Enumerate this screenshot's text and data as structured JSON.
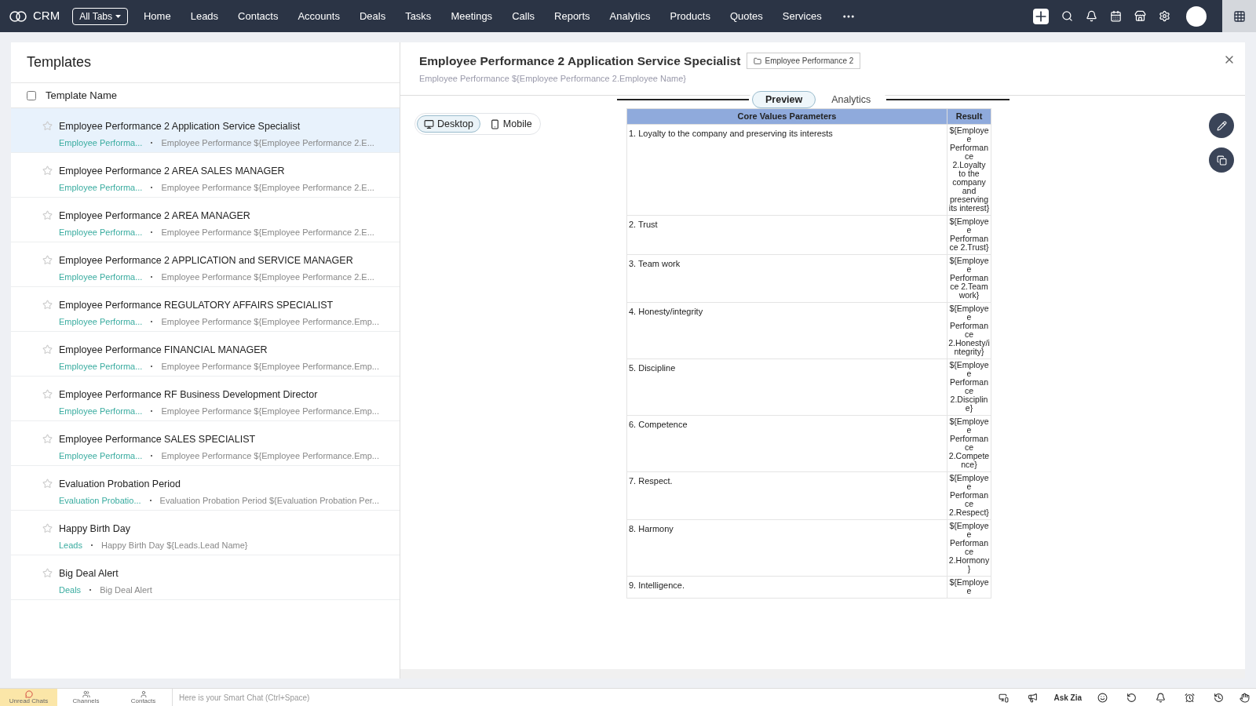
{
  "app": {
    "name": "CRM",
    "tabs_menu": "All Tabs"
  },
  "nav": [
    "Home",
    "Leads",
    "Contacts",
    "Accounts",
    "Deals",
    "Tasks",
    "Meetings",
    "Calls",
    "Reports",
    "Analytics",
    "Products",
    "Quotes",
    "Services"
  ],
  "templates": {
    "title": "Templates",
    "column": "Template Name",
    "select_all": false,
    "items": [
      {
        "name": "Employee Performance 2 Application Service Specialist",
        "module": "Employee Performa...",
        "subject": "Employee Performance ${Employee Performance 2.E...",
        "selected": true
      },
      {
        "name": "Employee Performance 2 AREA SALES MANAGER",
        "module": "Employee Performa...",
        "subject": "Employee Performance ${Employee Performance 2.E...",
        "selected": false
      },
      {
        "name": "Employee Performance 2 AREA MANAGER",
        "module": "Employee Performa...",
        "subject": "Employee Performance ${Employee Performance 2.E...",
        "selected": false
      },
      {
        "name": "Employee Performance 2 APPLICATION and SERVICE MANAGER",
        "module": "Employee Performa...",
        "subject": "Employee Performance ${Employee Performance 2.E...",
        "selected": false
      },
      {
        "name": "Employee Performance REGULATORY AFFAIRS SPECIALIST",
        "module": "Employee Performa...",
        "subject": "Employee Performance ${Employee Performance.Emp...",
        "selected": false
      },
      {
        "name": "Employee Performance FINANCIAL MANAGER",
        "module": "Employee Performa...",
        "subject": "Employee Performance ${Employee Performance.Emp...",
        "selected": false
      },
      {
        "name": "Employee Performance RF Business Development Director",
        "module": "Employee Performa...",
        "subject": "Employee Performance ${Employee Performance.Emp...",
        "selected": false
      },
      {
        "name": "Employee Performance SALES SPECIALIST",
        "module": "Employee Performa...",
        "subject": "Employee Performance ${Employee Performance.Emp...",
        "selected": false
      },
      {
        "name": "Evaluation Probation Period",
        "module": "Evaluation Probatio...",
        "subject": "Evaluation Probation Period ${Evaluation Probation Per...",
        "selected": false
      },
      {
        "name": "Happy Birth Day",
        "module": "Leads",
        "subject": "Happy Birth Day ${Leads.Lead Name}",
        "selected": false
      },
      {
        "name": "Big Deal Alert",
        "module": "Deals",
        "subject": "Big Deal Alert",
        "selected": false
      }
    ]
  },
  "detail": {
    "title": "Employee Performance 2 Application Service Specialist",
    "module": "Employee Performance 2",
    "subject": "Employee Performance ${Employee Performance 2.Employee Name}",
    "tabs": [
      {
        "label": "Preview",
        "selected": true
      },
      {
        "label": "Analytics",
        "selected": false
      }
    ],
    "views": [
      {
        "label": "Desktop",
        "kind": "desktop",
        "selected": true
      },
      {
        "label": "Mobile",
        "kind": "mobile",
        "selected": false
      }
    ],
    "table": {
      "columns": [
        "Core Values Parameters",
        "Result"
      ],
      "rows": [
        [
          "1. Loyalty to the company and preserving its interests",
          "${Employee Performance 2.Loyalty to the company and preserving its interest}"
        ],
        [
          "2. Trust",
          "${Employee Performance 2.Trust}"
        ],
        [
          "3. Team work",
          "${Employee Performance 2.Team work}"
        ],
        [
          "4. Honesty/integrity",
          "${Employee Performance 2.Honesty/integrity}"
        ],
        [
          "5. Discipline",
          "${Employee Performance 2.Discipline}"
        ],
        [
          "6. Competence",
          "${Employee Performance 2.Competence}"
        ],
        [
          "7. Respect.",
          "${Employee Performance 2.Respect}"
        ],
        [
          "8. Harmony",
          "${Employee Performance 2.Hormony}"
        ],
        [
          "9. Intelligence.",
          "${Employee"
        ]
      ]
    }
  },
  "chatbar": {
    "items": [
      "Unread Chats",
      "Channels",
      "Contacts"
    ],
    "placeholder": "Here is your Smart Chat (Ctrl+Space)",
    "ask": "Ask Zia"
  }
}
